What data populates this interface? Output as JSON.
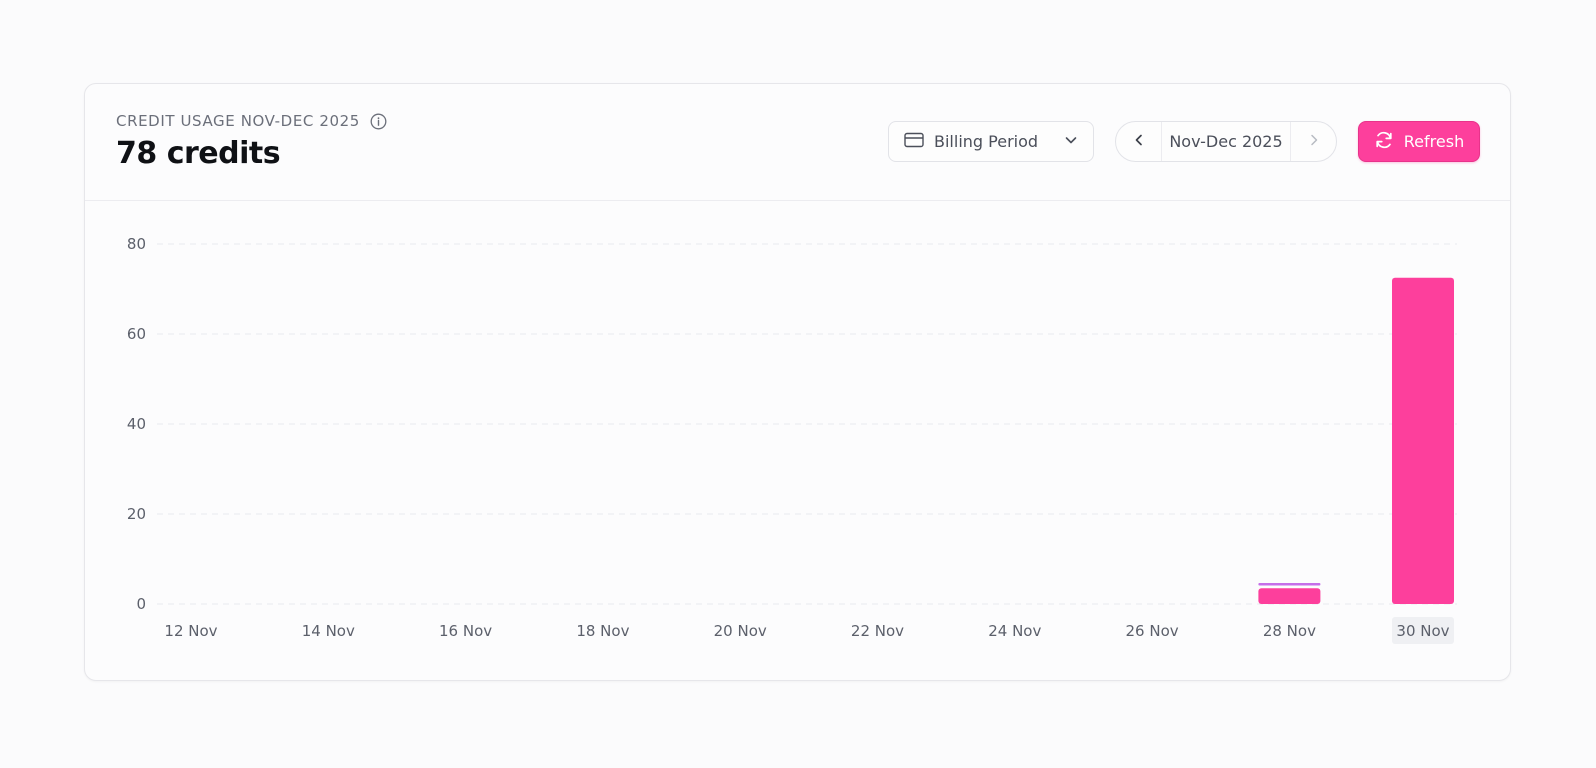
{
  "header": {
    "title": "CREDIT USAGE NOV-DEC 2025",
    "total": "78 credits"
  },
  "controls": {
    "billing_label": "Billing Period",
    "period_label": "Nov-Dec 2025",
    "refresh_label": "Refresh"
  },
  "icons": {
    "info": "info-icon",
    "billing": "credit-card-icon",
    "dropdown": "chevron-down-icon",
    "prev": "chevron-left-icon",
    "next": "chevron-right-icon",
    "refresh": "refresh-icon"
  },
  "colors": {
    "accent": "#fd3f9c",
    "secondary_series": "#c56ee9"
  },
  "chart_data": {
    "type": "bar",
    "title": "",
    "xlabel": "",
    "ylabel": "",
    "ylim": [
      0,
      80
    ],
    "yticks": [
      0,
      20,
      40,
      60,
      80
    ],
    "x_ticks": [
      "12 Nov",
      "14 Nov",
      "16 Nov",
      "18 Nov",
      "20 Nov",
      "22 Nov",
      "24 Nov",
      "26 Nov",
      "28 Nov",
      "30 Nov"
    ],
    "highlighted_tick": "30 Nov",
    "grid": true,
    "categories": [
      "28 Nov",
      "30 Nov"
    ],
    "series": [
      {
        "values": [
          3.5,
          72.5
        ],
        "color": "#fd3f9c"
      },
      {
        "values": [
          0.5,
          0
        ],
        "color": "#c56ee9"
      }
    ]
  }
}
